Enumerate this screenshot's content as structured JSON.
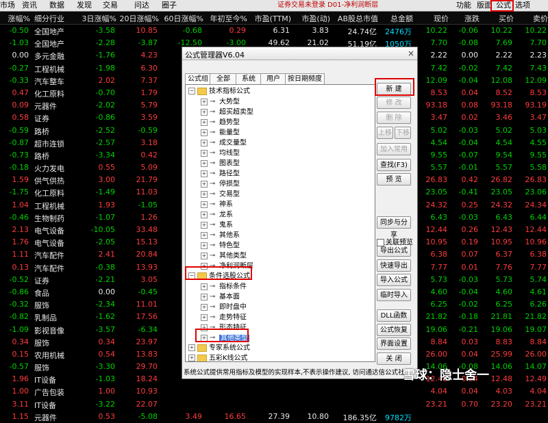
{
  "menubar": {
    "items": [
      "市场",
      "资讯",
      "数据",
      "发现",
      "交易",
      "问达",
      "圈子"
    ],
    "status": "证券交易未登录 D01-净利润断层",
    "right": [
      "功能",
      "版面",
      "公式",
      "选项"
    ]
  },
  "header": [
    "涨幅%",
    "细分行业",
    "3日涨幅%",
    "20日涨幅%",
    "60日涨幅%",
    "年初至今%",
    "市盈(TTM)",
    "市盈(动)",
    "AB股总市值",
    "总金额",
    "现价",
    "涨跌",
    "买价",
    "卖价"
  ],
  "rows": [
    [
      "-0.50",
      "全国地产",
      "-3.58",
      "10.85",
      "-0.68",
      "0.29",
      "6.31",
      "3.83",
      "24.74亿",
      "2476万",
      "10.22",
      "-0.06",
      "10.22",
      "10.22"
    ],
    [
      "-1.03",
      "全国地产",
      "-2.28",
      "-3.87",
      "-12.50",
      "-3.00",
      "49.62",
      "21.02",
      "51.19亿",
      "1050万",
      "7.70",
      "-0.08",
      "7.69",
      "7.70"
    ],
    [
      "0.00",
      "多元金融",
      "-1.76",
      "4.23",
      "",
      "",
      "",
      "",
      "",
      "",
      "2.22",
      "0.00",
      "2.22",
      "2.23"
    ],
    [
      "-0.27",
      "工程机械",
      "-1.98",
      "6.30",
      "",
      "",
      "",
      "",
      "",
      "",
      "7.42",
      "-0.02",
      "7.42",
      "7.43"
    ],
    [
      "-0.33",
      "汽车整车",
      "2.02",
      "7.37",
      "",
      "",
      "",
      "",
      "",
      "",
      "12.09",
      "-0.04",
      "12.08",
      "12.09"
    ],
    [
      "0.47",
      "化工原料",
      "-0.70",
      "1.79",
      "",
      "",
      "",
      "",
      "",
      "",
      "8.53",
      "0.04",
      "8.52",
      "8.53"
    ],
    [
      "0.09",
      "元器件",
      "-2.02",
      "5.79",
      "",
      "",
      "",
      "",
      "",
      "",
      "93.18",
      "0.08",
      "93.18",
      "93.19"
    ],
    [
      "0.58",
      "证券",
      "-0.86",
      "3.59",
      "",
      "",
      "",
      "",
      "",
      "",
      "3.47",
      "0.02",
      "3.46",
      "3.47"
    ],
    [
      "-0.59",
      "路桥",
      "-2.52",
      "-0.59",
      "",
      "",
      "",
      "",
      "",
      "",
      "5.02",
      "-0.03",
      "5.02",
      "5.03"
    ],
    [
      "-0.87",
      "超市连锁",
      "-2.57",
      "3.18",
      "",
      "",
      "",
      "",
      "",
      "",
      "4.54",
      "-0.04",
      "4.54",
      "4.55"
    ],
    [
      "-0.73",
      "路桥",
      "-3.34",
      "0.42",
      "",
      "",
      "",
      "",
      "",
      "",
      "9.55",
      "-0.07",
      "9.54",
      "9.55"
    ],
    [
      "-0.18",
      "火力发电",
      "0.55",
      "5.09",
      "",
      "",
      "",
      "",
      "",
      "",
      "5.57",
      "-0.01",
      "5.57",
      "5.58"
    ],
    [
      "1.59",
      "供气供热",
      "3.00",
      "21.79",
      "",
      "",
      "",
      "",
      "",
      "",
      "26.83",
      "0.42",
      "26.82",
      "26.83"
    ],
    [
      "-1.75",
      "化工原料",
      "-1.49",
      "11.03",
      "",
      "",
      "",
      "",
      "",
      "",
      "23.05",
      "-0.41",
      "23.05",
      "23.06"
    ],
    [
      "1.04",
      "工程机械",
      "1.93",
      "-1.05",
      "",
      "",
      "",
      "",
      "",
      "",
      "24.32",
      "0.25",
      "24.32",
      "24.34"
    ],
    [
      "-0.46",
      "生物制药",
      "-1.07",
      "1.26",
      "",
      "",
      "",
      "",
      "",
      "",
      "6.43",
      "-0.03",
      "6.43",
      "6.44"
    ],
    [
      "2.13",
      "电气设备",
      "-10.05",
      "33.48",
      "",
      "",
      "",
      "",
      "",
      "",
      "12.44",
      "0.26",
      "12.43",
      "12.44"
    ],
    [
      "1.76",
      "电气设备",
      "-2.05",
      "15.13",
      "",
      "",
      "",
      "",
      "",
      "",
      "10.95",
      "0.19",
      "10.95",
      "10.96"
    ],
    [
      "1.11",
      "汽车配件",
      "2.41",
      "20.84",
      "",
      "",
      "",
      "",
      "",
      "",
      "6.38",
      "0.07",
      "6.37",
      "6.38"
    ],
    [
      "0.13",
      "汽车配件",
      "-0.38",
      "13.93",
      "",
      "",
      "",
      "",
      "",
      "",
      "7.77",
      "0.01",
      "7.76",
      "7.77"
    ],
    [
      "-0.52",
      "证券",
      "-2.21",
      "3.05",
      "",
      "",
      "",
      "",
      "",
      "",
      "5.73",
      "-0.03",
      "5.73",
      "5.74"
    ],
    [
      "-0.86",
      "食品",
      "0.00",
      "-0.45",
      "",
      "",
      "",
      "",
      "",
      "",
      "4.60",
      "-0.04",
      "4.60",
      "4.61"
    ],
    [
      "-0.32",
      "服饰",
      "-2.34",
      "11.01",
      "",
      "",
      "",
      "",
      "",
      "",
      "6.25",
      "-0.02",
      "6.25",
      "6.26"
    ],
    [
      "-0.82",
      "乳制品",
      "-1.62",
      "17.56",
      "",
      "",
      "",
      "",
      "",
      "",
      "21.82",
      "-0.18",
      "21.81",
      "21.82"
    ],
    [
      "-1.09",
      "影视音像",
      "-3.57",
      "-6.34",
      "",
      "",
      "",
      "",
      "",
      "",
      "19.06",
      "-0.21",
      "19.06",
      "19.07"
    ],
    [
      "0.34",
      "服饰",
      "0.34",
      "23.97",
      "",
      "",
      "",
      "",
      "",
      "",
      "8.84",
      "0.03",
      "8.83",
      "8.84"
    ],
    [
      "0.15",
      "农用机械",
      "0.54",
      "13.83",
      "",
      "",
      "",
      "",
      "",
      "",
      "26.00",
      "0.04",
      "25.99",
      "26.00"
    ],
    [
      "-0.57",
      "服饰",
      "-3.30",
      "29.70",
      "",
      "",
      "",
      "",
      "",
      "",
      "14.06",
      "-0.08",
      "14.06",
      "14.07"
    ],
    [
      "1.96",
      "IT设备",
      "-1.03",
      "18.24",
      "",
      "",
      "",
      "",
      "",
      "",
      "12.48",
      "0.24",
      "12.48",
      "12.49"
    ],
    [
      "1.00",
      "广告包装",
      "1.00",
      "10.93",
      "",
      "",
      "",
      "",
      "",
      "",
      "4.04",
      "0.04",
      "4.03",
      "4.04"
    ],
    [
      "3.11",
      "IT设备",
      "-3.22",
      "22.07",
      "",
      "",
      "",
      "",
      "",
      "",
      "23.21",
      "0.70",
      "23.20",
      "23.21"
    ],
    [
      "1.15",
      "元器件",
      "0.53",
      "-5.08",
      "3.49",
      "16.65",
      "27.39",
      "10.80",
      "186.35亿",
      "9782万",
      "",
      "",
      "",
      ""
    ]
  ],
  "dialog": {
    "title": "公式管理器V6.04",
    "close": "×",
    "tabs": [
      "公式组",
      "全部",
      "系统",
      "用户",
      "按日期频度"
    ],
    "tree": [
      {
        "label": "技术指标公式",
        "level": 0,
        "type": "folder",
        "exp": "⊟"
      },
      {
        "label": "大势型",
        "level": 1,
        "type": "key",
        "exp": "⊞"
      },
      {
        "label": "超买超卖型",
        "level": 1,
        "type": "key",
        "exp": "⊞"
      },
      {
        "label": "趋势型",
        "level": 1,
        "type": "key",
        "exp": "⊞"
      },
      {
        "label": "能量型",
        "level": 1,
        "type": "key",
        "exp": "⊞"
      },
      {
        "label": "成交量型",
        "level": 1,
        "type": "key",
        "exp": "⊞"
      },
      {
        "label": "均线型",
        "level": 1,
        "type": "key",
        "exp": "⊞"
      },
      {
        "label": "图表型",
        "level": 1,
        "type": "key",
        "exp": "⊞"
      },
      {
        "label": "路径型",
        "level": 1,
        "type": "key",
        "exp": "⊞"
      },
      {
        "label": "停损型",
        "level": 1,
        "type": "key",
        "exp": "⊞"
      },
      {
        "label": "交易型",
        "level": 1,
        "type": "key",
        "exp": "⊞"
      },
      {
        "label": "神系",
        "level": 1,
        "type": "key",
        "exp": "⊞"
      },
      {
        "label": "龙系",
        "level": 1,
        "type": "key",
        "exp": "⊞"
      },
      {
        "label": "鬼系",
        "level": 1,
        "type": "key",
        "exp": "⊞"
      },
      {
        "label": "其他系",
        "level": 1,
        "type": "key",
        "exp": "⊞"
      },
      {
        "label": "特色型",
        "level": 1,
        "type": "key",
        "exp": "⊞"
      },
      {
        "label": "其他类型",
        "level": 1,
        "type": "key",
        "exp": "⊞"
      },
      {
        "label": "净利润断层",
        "level": 1,
        "type": "key",
        "exp": "⊞"
      },
      {
        "label": "条件选股公式",
        "level": 0,
        "type": "folder",
        "exp": "⊟"
      },
      {
        "label": "指标条件",
        "level": 1,
        "type": "key",
        "exp": "⊞"
      },
      {
        "label": "基本面",
        "level": 1,
        "type": "key",
        "exp": "⊞"
      },
      {
        "label": "即时盘中",
        "level": 1,
        "type": "key",
        "exp": "⊞"
      },
      {
        "label": "走势特征",
        "level": 1,
        "type": "key",
        "exp": "⊞"
      },
      {
        "label": "形态特征",
        "level": 1,
        "type": "key",
        "exp": "⊞"
      },
      {
        "label": "其他类型",
        "level": 1,
        "type": "key",
        "exp": "⊞",
        "selected": true
      },
      {
        "label": "专家系统公式",
        "level": 0,
        "type": "folder",
        "exp": "⊞"
      },
      {
        "label": "五彩K线公式",
        "level": 0,
        "type": "folder",
        "exp": "⊞"
      }
    ],
    "buttons": [
      {
        "label": "新 建",
        "disabled": false
      },
      {
        "label": "修 改",
        "disabled": true
      },
      {
        "label": "删 除",
        "disabled": true
      },
      {
        "label": "上移",
        "disabled": true
      },
      {
        "label": "下移",
        "disabled": true
      },
      {
        "label": "加入常用",
        "disabled": true
      },
      {
        "label": "查找(F3)",
        "disabled": false
      },
      {
        "label": "预 览",
        "disabled": false
      },
      {
        "label": "同步与分享",
        "disabled": false
      },
      {
        "label": "导出公式",
        "disabled": false
      },
      {
        "label": "快速导出",
        "disabled": false
      },
      {
        "label": "导入公式",
        "disabled": false
      },
      {
        "label": "临时导入",
        "disabled": false
      },
      {
        "label": "DLL函数",
        "disabled": false
      },
      {
        "label": "公式恢复",
        "disabled": false
      },
      {
        "label": "界面设置",
        "disabled": false
      },
      {
        "label": "关 闭",
        "disabled": false
      }
    ],
    "checkbox_label": "关联预览",
    "status": "系统公式提供常用指标及模型的实现样本,不表示操作建议, 访问通达信公式社区"
  },
  "watermark": "雪球：隐士舍一"
}
